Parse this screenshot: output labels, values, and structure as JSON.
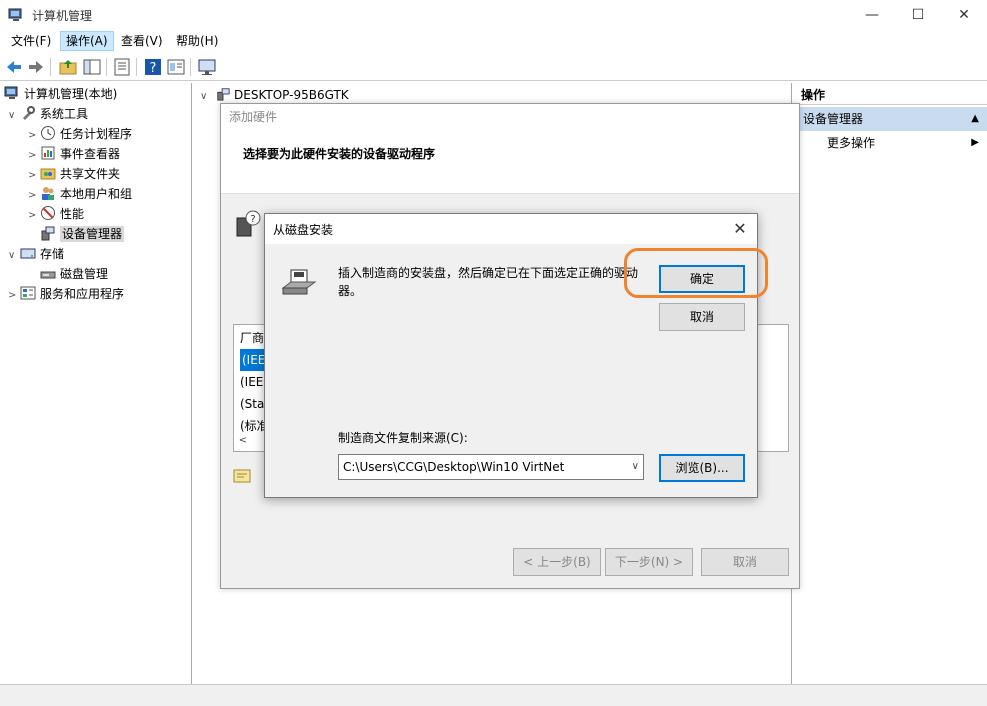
{
  "window": {
    "title": "计算机管理",
    "minimize": "—",
    "maximize": "☐",
    "close": "✕"
  },
  "menubar": {
    "items": [
      "文件(F)",
      "操作(A)",
      "查看(V)",
      "帮助(H)"
    ],
    "active_index": 1
  },
  "toolbar": {
    "icons": [
      "back-arrow-icon",
      "forward-arrow-icon",
      "folder-up-icon",
      "show-hide-tree-icon",
      "properties-icon",
      "help-icon",
      "view-icon",
      "monitor-icon"
    ]
  },
  "tree": {
    "items": [
      {
        "label": "计算机管理(本地)",
        "level": 0,
        "arrow": "",
        "icon": "computer-management-icon"
      },
      {
        "label": "系统工具",
        "level": 1,
        "arrow": "∨",
        "icon": "system-tools-icon"
      },
      {
        "label": "任务计划程序",
        "level": 2,
        "arrow": ">",
        "icon": "clock-icon"
      },
      {
        "label": "事件查看器",
        "level": 2,
        "arrow": ">",
        "icon": "event-viewer-icon"
      },
      {
        "label": "共享文件夹",
        "level": 2,
        "arrow": ">",
        "icon": "shared-folder-icon"
      },
      {
        "label": "本地用户和组",
        "level": 2,
        "arrow": ">",
        "icon": "users-icon"
      },
      {
        "label": "性能",
        "level": 2,
        "arrow": ">",
        "icon": "performance-icon"
      },
      {
        "label": "设备管理器",
        "level": 2,
        "arrow": "",
        "icon": "device-manager-icon",
        "selected": true
      },
      {
        "label": "存储",
        "level": 1,
        "arrow": "∨",
        "icon": "storage-icon"
      },
      {
        "label": "磁盘管理",
        "level": 2,
        "arrow": "",
        "icon": "disk-management-icon"
      },
      {
        "label": "服务和应用程序",
        "level": 1,
        "arrow": ">",
        "icon": "services-icon"
      }
    ]
  },
  "center": {
    "header": "DESKTOP-95B6GTK",
    "header_arrow": "∨"
  },
  "actions_pane": {
    "title": "操作",
    "section": "设备管理器",
    "section_arrow": "▲",
    "more": "更多操作",
    "more_arrow": "▶"
  },
  "wizard": {
    "title": "添加硬件",
    "header": "选择要为此硬件安装的设备驱动程序",
    "list_header": "厂商",
    "list_rows": [
      "(IEE",
      "(IEE",
      "(Sta",
      "(标准"
    ],
    "scroll_left": "<",
    "back_button": "< 上一步(B)",
    "next_button": "下一步(N) >",
    "cancel_button": "取消"
  },
  "dialog": {
    "title": "从磁盘安装",
    "close": "✕",
    "message": "插入制造商的安装盘，然后确定已在下面选定正确的驱动器。",
    "ok_button": "确定",
    "cancel_button": "取消",
    "source_label": "制造商文件复制来源(C):",
    "source_value": "C:\\Users\\CCG\\Desktop\\Win10 VirtNet",
    "combo_arrow": "∨",
    "browse_button": "浏览(B)...",
    "highlight_color": "#f0832f"
  }
}
